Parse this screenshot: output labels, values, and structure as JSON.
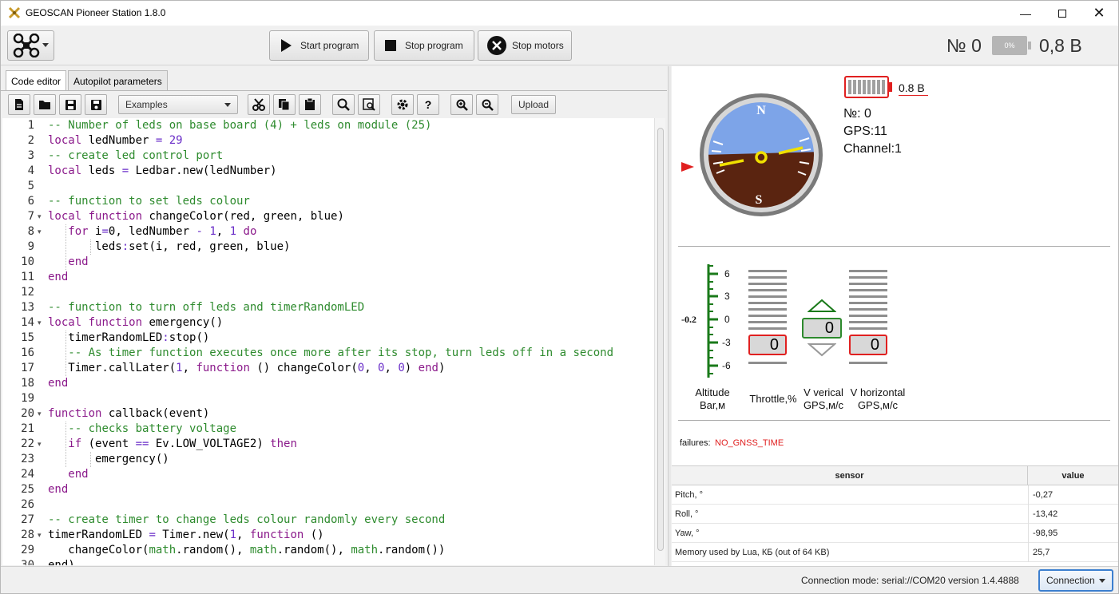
{
  "window": {
    "title": "GEOSCAN Pioneer Station 1.8.0"
  },
  "toolbar": {
    "start_label": "Start program",
    "stop_label": "Stop program",
    "stop_motors_label": "Stop motors",
    "drone_number": "№ 0",
    "battery_percent": "0%",
    "voltage": "0,8 В"
  },
  "tabs": [
    {
      "label": "Code editor",
      "active": true
    },
    {
      "label": "Autopilot parameters",
      "active": false
    }
  ],
  "editor_toolbar": {
    "examples_label": "Examples",
    "upload_label": "Upload"
  },
  "code_lines": [
    {
      "n": "1",
      "fold": ""
    },
    {
      "n": "2",
      "fold": ""
    },
    {
      "n": "3",
      "fold": ""
    },
    {
      "n": "4",
      "fold": ""
    },
    {
      "n": "5",
      "fold": ""
    },
    {
      "n": "6",
      "fold": ""
    },
    {
      "n": "7",
      "fold": "▾"
    },
    {
      "n": "8",
      "fold": "▾"
    },
    {
      "n": "9",
      "fold": ""
    },
    {
      "n": "10",
      "fold": ""
    },
    {
      "n": "11",
      "fold": ""
    },
    {
      "n": "12",
      "fold": ""
    },
    {
      "n": "13",
      "fold": ""
    },
    {
      "n": "14",
      "fold": "▾"
    },
    {
      "n": "15",
      "fold": ""
    },
    {
      "n": "16",
      "fold": ""
    },
    {
      "n": "17",
      "fold": ""
    },
    {
      "n": "18",
      "fold": ""
    },
    {
      "n": "19",
      "fold": ""
    },
    {
      "n": "20",
      "fold": "▾"
    },
    {
      "n": "21",
      "fold": ""
    },
    {
      "n": "22",
      "fold": "▾"
    },
    {
      "n": "23",
      "fold": ""
    },
    {
      "n": "24",
      "fold": ""
    },
    {
      "n": "25",
      "fold": ""
    },
    {
      "n": "26",
      "fold": ""
    },
    {
      "n": "27",
      "fold": ""
    },
    {
      "n": "28",
      "fold": "▾"
    },
    {
      "n": "29",
      "fold": ""
    },
    {
      "n": "30",
      "fold": ""
    }
  ],
  "code": [
    [
      [
        "-- Number of leds on base board (4) + leds on module (25)",
        "c"
      ]
    ],
    [
      [
        "local",
        "k"
      ],
      [
        " ledNumber ",
        ""
      ],
      [
        "=",
        "o"
      ],
      [
        " ",
        ""
      ],
      [
        "29",
        "n"
      ]
    ],
    [
      [
        "-- create led control port",
        "c"
      ]
    ],
    [
      [
        "local",
        "k"
      ],
      [
        " leds ",
        ""
      ],
      [
        "=",
        "o"
      ],
      [
        " Ledbar.new(ledNumber)",
        ""
      ]
    ],
    [
      [
        "",
        ""
      ]
    ],
    [
      [
        "-- function to set leds colour",
        "c"
      ]
    ],
    [
      [
        "local",
        "k"
      ],
      [
        " ",
        ""
      ],
      [
        "function",
        "k"
      ],
      [
        " changeColor(red, green, blue)",
        ""
      ]
    ],
    [
      [
        "   ",
        ""
      ],
      [
        "for",
        "k"
      ],
      [
        " i",
        ""
      ],
      [
        "=",
        "o"
      ],
      [
        "0",
        ""
      ],
      [
        ", ledNumber ",
        ""
      ],
      [
        "-",
        "o"
      ],
      [
        " ",
        ""
      ],
      [
        "1",
        "n"
      ],
      [
        ", ",
        ""
      ],
      [
        "1",
        "n"
      ],
      [
        " ",
        ""
      ],
      [
        "do",
        "k"
      ]
    ],
    [
      [
        "       leds",
        ""
      ],
      [
        ":",
        "o"
      ],
      [
        "set(i, red, green, blue)",
        ""
      ]
    ],
    [
      [
        "   ",
        ""
      ],
      [
        "end",
        "k"
      ]
    ],
    [
      [
        "end",
        "k"
      ]
    ],
    [
      [
        "",
        ""
      ]
    ],
    [
      [
        "-- function to turn off leds and timerRandomLED",
        "c"
      ]
    ],
    [
      [
        "local",
        "k"
      ],
      [
        " ",
        ""
      ],
      [
        "function",
        "k"
      ],
      [
        " emergency()",
        ""
      ]
    ],
    [
      [
        "   timerRandomLED",
        ""
      ],
      [
        ":",
        "o"
      ],
      [
        "stop()",
        ""
      ]
    ],
    [
      [
        "   ",
        ""
      ],
      [
        "-- As timer function executes once more after its stop, turn leds off in a second",
        "c"
      ]
    ],
    [
      [
        "   Timer.callLater(",
        ""
      ],
      [
        "1",
        "n"
      ],
      [
        ", ",
        ""
      ],
      [
        "function",
        "k"
      ],
      [
        " () changeColor(",
        ""
      ],
      [
        "0",
        "n"
      ],
      [
        ", ",
        ""
      ],
      [
        "0",
        "n"
      ],
      [
        ", ",
        ""
      ],
      [
        "0",
        "n"
      ],
      [
        ") ",
        ""
      ],
      [
        "end",
        "k"
      ],
      [
        ")",
        ""
      ]
    ],
    [
      [
        "end",
        "k"
      ]
    ],
    [
      [
        "",
        ""
      ]
    ],
    [
      [
        "function",
        "k"
      ],
      [
        " callback(event)",
        ""
      ]
    ],
    [
      [
        "   ",
        ""
      ],
      [
        "-- checks battery voltage",
        "c"
      ]
    ],
    [
      [
        "   ",
        ""
      ],
      [
        "if",
        "k"
      ],
      [
        " (event ",
        ""
      ],
      [
        "==",
        "o"
      ],
      [
        " Ev.LOW_VOLTAGE2) ",
        ""
      ],
      [
        "then",
        "k"
      ]
    ],
    [
      [
        "       emergency()",
        ""
      ]
    ],
    [
      [
        "   ",
        ""
      ],
      [
        "end",
        "k"
      ]
    ],
    [
      [
        "end",
        "k"
      ]
    ],
    [
      [
        "",
        ""
      ]
    ],
    [
      [
        "-- create timer to change leds colour randomly every second",
        "c"
      ]
    ],
    [
      [
        "timerRandomLED ",
        ""
      ],
      [
        "=",
        "o"
      ],
      [
        " Timer.new(",
        ""
      ],
      [
        "1",
        "n"
      ],
      [
        ", ",
        ""
      ],
      [
        "function",
        "k"
      ],
      [
        " ()",
        ""
      ]
    ],
    [
      [
        "   changeColor(",
        ""
      ],
      [
        "math",
        "g"
      ],
      [
        ".random(), ",
        ""
      ],
      [
        "math",
        "g"
      ],
      [
        ".random(), ",
        ""
      ],
      [
        "math",
        "g"
      ],
      [
        ".random())",
        ""
      ]
    ],
    [
      [
        "end)",
        ""
      ]
    ]
  ],
  "telemetry": {
    "battery_voltage": "0.8 В",
    "number": "№: 0",
    "gps": "GPS:11",
    "channel": "Channel:1",
    "horizon_n": "N",
    "horizon_s": "S",
    "altitude_value": "-0.2",
    "altitude_ticks": [
      "6",
      "3",
      "0",
      "-3",
      "-6"
    ],
    "throttle_value": "0",
    "v_vertical_value": "0",
    "v_horizontal_value": "0",
    "altitude_label_1": "Altitude",
    "altitude_label_2": "Bar,м",
    "throttle_label": "Throttle,%",
    "vvert_label_1": "V verical",
    "vvert_label_2": "GPS,м/с",
    "vhor_label_1": "V horizontal",
    "vhor_label_2": "GPS,м/с",
    "failures_label": "failures:",
    "failures_value": "NO_GNSS_TIME"
  },
  "sensor_table": {
    "headers": [
      "sensor",
      "value"
    ],
    "rows": [
      {
        "sensor": "Pitch, °",
        "value": "-0,27"
      },
      {
        "sensor": "Roll, °",
        "value": "-13,42"
      },
      {
        "sensor": "Yaw, °",
        "value": "-98,95"
      },
      {
        "sensor": "Memory used by Lua, КБ (out of 64 KB)",
        "value": "25,7"
      }
    ]
  },
  "statusbar": {
    "connection_text": "Connection mode: serial://COM20  version 1.4.4888",
    "connection_button": "Connection"
  },
  "colors": {
    "keyword": "#8b1a8b",
    "comment": "#2e8b2e",
    "number": "#6a2ec8",
    "operator": "#6a2ec8",
    "global": "#2e8b2e",
    "alert": "#e02020"
  }
}
